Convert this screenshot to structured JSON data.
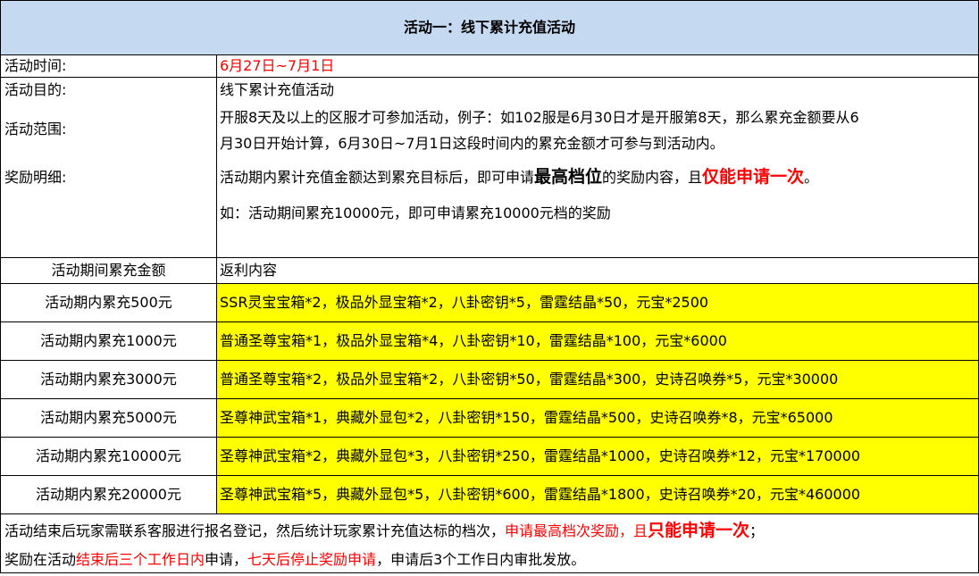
{
  "title": "活动一：线下累计充值活动",
  "info": {
    "time_label": "活动时间:",
    "time_value": "6月27日~7月1日",
    "purpose_label": "活动目的:",
    "purpose_value": "线下累计充值活动",
    "scope_label": "活动范围:",
    "scope_line1": "开服8天及以上的区服才可参加活动，例子：如102服是6月30日才是开服第8天，那么累充金额要从6",
    "scope_line2": "月30日开始计算，6月30日~7月1日这段时间内的累充金额才可参与到活动内。",
    "reward_label": "奖励明细:",
    "reward_line_a": "活动期内累计充值金额达到累充目标后，即可申请",
    "reward_line_b": "最高档位",
    "reward_line_c": "的奖励内容，且",
    "reward_line_d": "仅能申请一次",
    "reward_line_e": "。",
    "example": "如：活动期间累充10000元，即可申请累充10000元档的奖励"
  },
  "table": {
    "header_amount": "活动期间累充金额",
    "header_rewards": "返利内容",
    "rows": [
      {
        "tier": "活动期内累充500元",
        "rewards": "SSR灵宝宝箱*2，极品外显宝箱*2，八卦密钥*5，雷霆结晶*50，元宝*2500"
      },
      {
        "tier": "活动期内累充1000元",
        "rewards": "普通圣尊宝箱*1，极品外显宝箱*4，八卦密钥*10，雷霆结晶*100，元宝*6000"
      },
      {
        "tier": "活动期内累充3000元",
        "rewards": "普通圣尊宝箱*2，极品外显宝箱*2，八卦密钥*50，雷霆结晶*300，史诗召唤券*5，元宝*30000"
      },
      {
        "tier": "活动期内累充5000元",
        "rewards": "圣尊神武宝箱*1，典藏外显包*2，八卦密钥*150，雷霆结晶*500，史诗召唤券*8，元宝*65000"
      },
      {
        "tier": "活动期内累充10000元",
        "rewards": "圣尊神武宝箱*2，典藏外显包*3，八卦密钥*250，雷霆结晶*1000，史诗召唤券*12，元宝*170000"
      },
      {
        "tier": "活动期内累充20000元",
        "rewards": "圣尊神武宝箱*5，典藏外显包*5，八卦密钥*600，雷霆结晶*1800，史诗召唤券*20，元宝*460000"
      }
    ]
  },
  "footer": {
    "l1_a": "活动结束后玩家需联系客服进行报名登记，然后统计玩家累计充值达标的档次，",
    "l1_b": "申请最高档次奖励，且",
    "l1_c": "只能申请一次",
    "l1_d": "；",
    "l2_a": "奖励在活动",
    "l2_b": "结束后三个工作日内",
    "l2_c": "申请，",
    "l2_d": "七天后停止奖励申请",
    "l2_e": "，申请后3个工作日内审批发放。"
  },
  "colors": {
    "title_bg": "#c5d9f1",
    "reward_bg": "#ffff00",
    "highlight": "#ff0000"
  }
}
